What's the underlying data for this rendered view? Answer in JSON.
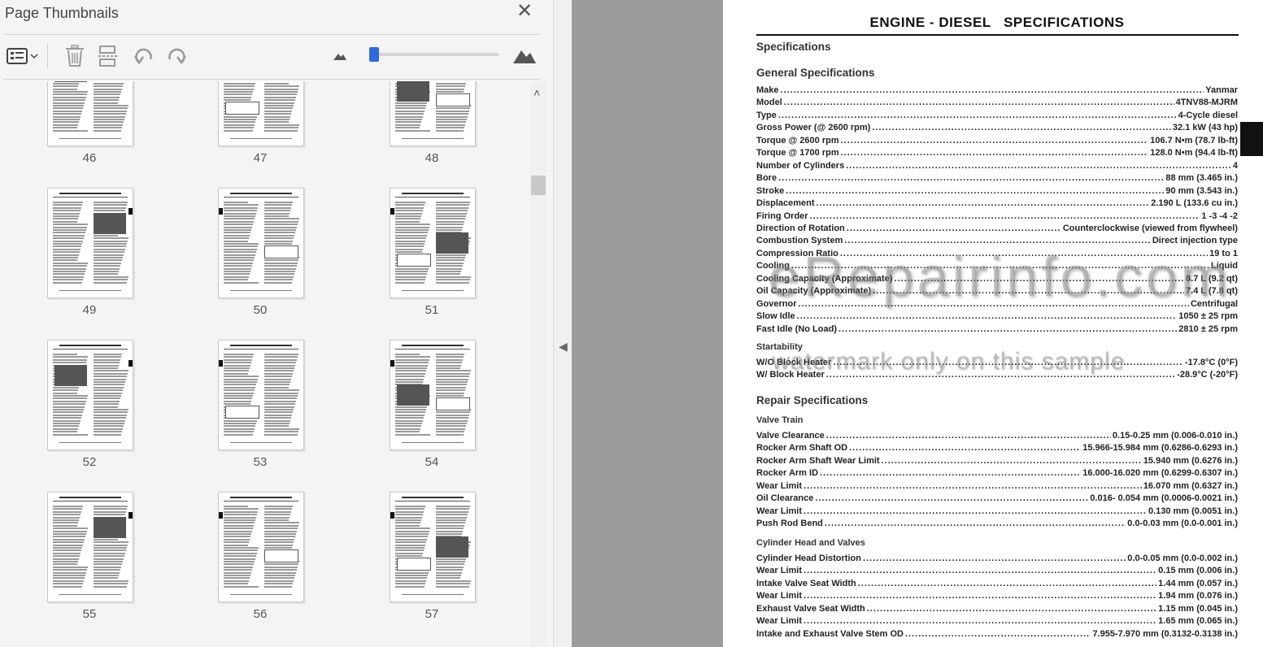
{
  "panel": {
    "title": "Page Thumbnails",
    "close_glyph": "✕",
    "toolbar": {
      "options_icon": "thumbnail-options-icon",
      "delete_icon": "trash-icon",
      "insert_icon": "insert-page-icon",
      "undo_icon": "undo-icon",
      "redo_icon": "redo-icon",
      "zoom_out_icon": "mountain-small-icon",
      "zoom_in_icon": "mountain-large-icon",
      "slider_value": 0
    },
    "pages": [
      "46",
      "47",
      "48",
      "49",
      "50",
      "51",
      "52",
      "53",
      "54",
      "55",
      "56",
      "57"
    ]
  },
  "document": {
    "title": "ENGINE - DIESEL   SPECIFICATIONS",
    "section": "Specifications",
    "general_heading": "General Specifications",
    "general": [
      {
        "label": "Make",
        "value": "Yanmar"
      },
      {
        "label": "Model",
        "value": "4TNV88-MJRM"
      },
      {
        "label": "Type",
        "value": "4-Cycle diesel"
      },
      {
        "label": "Gross Power (@ 2600 rpm)",
        "value": "32.1 kW (43 hp)"
      },
      {
        "label": "Torque @ 2600 rpm",
        "value": "106.7 N•m (78.7 lb-ft)"
      },
      {
        "label": "Torque @ 1700 rpm",
        "value": "128.0 N•m (94.4 lb-ft)"
      },
      {
        "label": "Number of Cylinders",
        "value": "4"
      },
      {
        "label": "Bore",
        "value": "88 mm (3.465 in.)"
      },
      {
        "label": "Stroke",
        "value": "90 mm (3.543 in.)"
      },
      {
        "label": "Displacement",
        "value": "2.190 L (133.6 cu in.)"
      },
      {
        "label": "Firing Order",
        "value": "1 -3 -4 -2"
      },
      {
        "label": "Direction of Rotation",
        "value": "Counterclockwise (viewed from flywheel)"
      },
      {
        "label": "Combustion System",
        "value": "Direct injection type"
      },
      {
        "label": "Compression Ratio",
        "value": "19 to 1"
      },
      {
        "label": "Cooling",
        "value": "Liquid"
      },
      {
        "label": "Cooling Capacity (Approximate)",
        "value": "8.7 L (9.2 qt)"
      },
      {
        "label": "Oil Capacity (Approximate)",
        "value": "7.4 L (7.8 qt)"
      },
      {
        "label": "Governor",
        "value": "Centrifugal"
      },
      {
        "label": "Slow Idle",
        "value": "1050 ± 25 rpm"
      },
      {
        "label": "Fast Idle (No Load)",
        "value": "2810 ± 25 rpm"
      }
    ],
    "startability_heading": "Startability",
    "startability": [
      {
        "label": "W/O Block Heater",
        "value": "-17.8°C (0°F)"
      },
      {
        "label": "W/ Block Heater",
        "value": "-28.9°C (-20°F)"
      }
    ],
    "repair_heading": "Repair Specifications",
    "valve_train_heading": "Valve Train",
    "valve_train": [
      {
        "label": "Valve Clearance",
        "value": "0.15-0.25 mm (0.006-0.010 in.)"
      },
      {
        "label": "Rocker Arm Shaft OD",
        "value": "15.966-15.984 mm (0.6286-0.6293 in.)"
      },
      {
        "label": "Rocker Arm Shaft Wear Limit",
        "value": "15.940 mm (0.6276 in.)"
      },
      {
        "label": "Rocker Arm ID",
        "value": "16.000-16.020 mm (0.6299-0.6307 in.)"
      },
      {
        "label": "Wear Limit",
        "value": "16.070 mm (0.6327 in.)"
      },
      {
        "label": "Oil Clearance",
        "value": "0.016- 0.054 mm (0.0006-0.0021 in.)"
      },
      {
        "label": "Wear Limit",
        "value": "0.130 mm (0.0051 in.)"
      },
      {
        "label": "Push Rod Bend",
        "value": "0.0-0.03 mm (0.0-0.001 in.)"
      }
    ],
    "cyl_heading": "Cylinder Head and Valves",
    "cylinder": [
      {
        "label": "Cylinder Head Distortion",
        "value": "0.0-0.05 mm (0.0-0.002 in.)"
      },
      {
        "label": "Wear Limit",
        "value": "0.15 mm (0.006 in.)"
      },
      {
        "label": "Intake Valve Seat Width",
        "value": "1.44 mm (0.057 in.)"
      },
      {
        "label": "Wear Limit",
        "value": "1.94 mm (0.076 in.)"
      },
      {
        "label": "Exhaust Valve Seat Width",
        "value": "1.15 mm (0.045 in.)"
      },
      {
        "label": "Wear Limit",
        "value": "1.65 mm (0.065 in.)"
      },
      {
        "label": "Intake and Exhaust Valve Stem OD",
        "value": "7.955-7.970 mm (0.3132-0.3138 in.)"
      }
    ],
    "watermark": "eRepairinfo.com",
    "watermark_sub": "watermark only on this sample"
  }
}
